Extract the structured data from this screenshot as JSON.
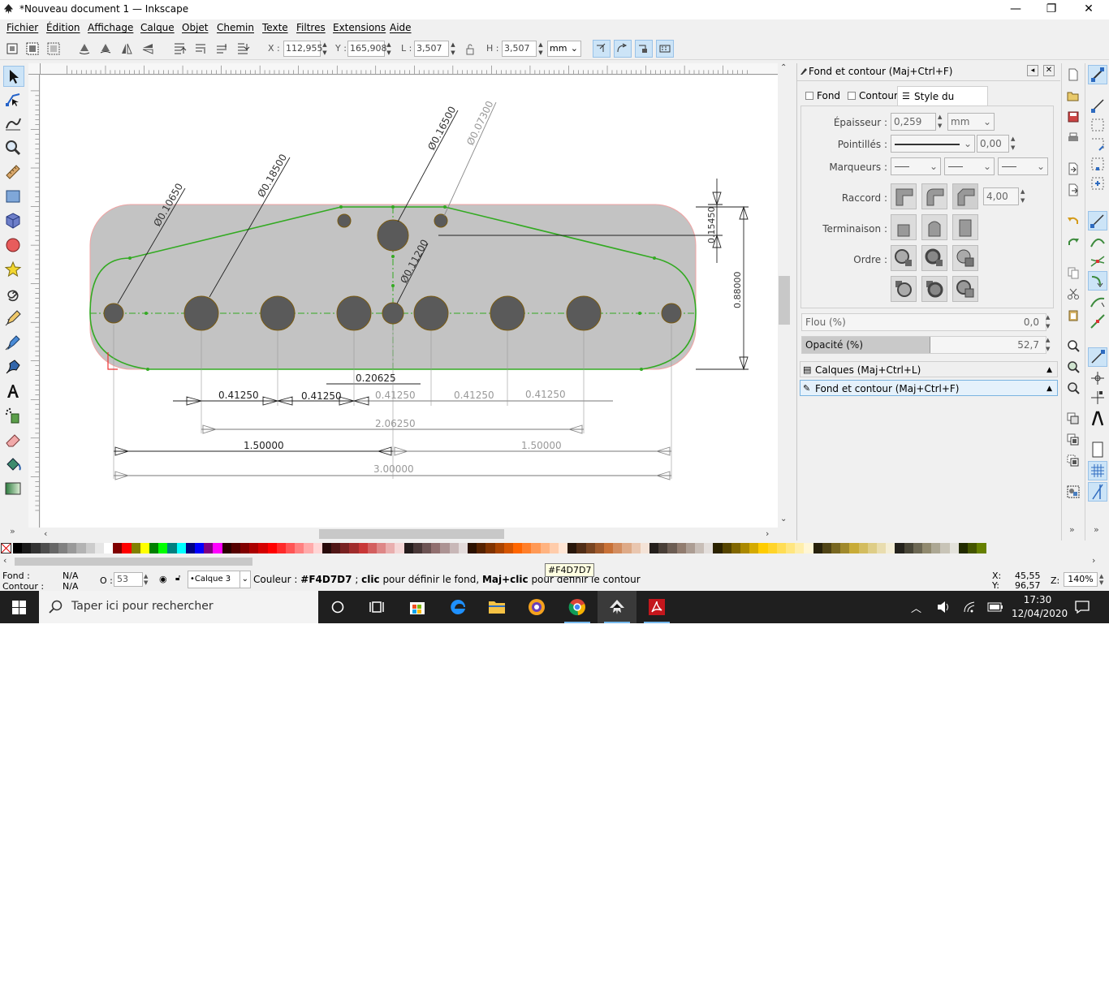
{
  "window": {
    "title": "*Nouveau document 1 — Inkscape",
    "minimize": "—",
    "restore": "❐",
    "close": "✕"
  },
  "menu": [
    "Fichier",
    "Édition",
    "Affichage",
    "Calque",
    "Objet",
    "Chemin",
    "Texte",
    "Filtres",
    "Extensions",
    "Aide"
  ],
  "controls": {
    "x_label": "X :",
    "x_value": "112,955",
    "y_label": "Y :",
    "y_value": "165,908",
    "w_label": "L :",
    "w_value": "3,507",
    "h_label": "H :",
    "h_value": "3,507",
    "unit": "mm"
  },
  "drawing": {
    "diameters": [
      "Ø0.10650",
      "Ø0.18500",
      "Ø0.16500",
      "Ø0.07300",
      "Ø0.11200"
    ],
    "dims": {
      "d_015450": "0.15450",
      "d_088000": "0.88000",
      "d_020625": "0.20625",
      "d_041250a": "0.41250",
      "d_041250b": "0.41250",
      "d_041250c": "0.41250",
      "d_041250d": "0.41250",
      "d_041250e": "0.41250",
      "d_206250": "2.06250",
      "d_150000a": "1.50000",
      "d_150000b": "1.50000",
      "d_300000": "3.00000"
    }
  },
  "dock": {
    "title": "Fond et contour (Maj+Ctrl+F)",
    "tabs": [
      "Fond",
      "Contour",
      "Style du contour"
    ],
    "stroke_width_label": "Épaisseur :",
    "stroke_width_value": "0,259",
    "stroke_unit": "mm",
    "dashes_label": "Pointillés :",
    "dash_offset": "0,00",
    "markers_label": "Marqueurs :",
    "join_label": "Raccord :",
    "miter_limit": "4,00",
    "cap_label": "Terminaison :",
    "order_label": "Ordre :",
    "blur_label": "Flou (%)",
    "blur_value": "0,0",
    "opacity_label": "Opacité (%)",
    "opacity_value": "52,7",
    "opacity_fraction": 0.527,
    "collapsed_dialog": "Calques (Maj+Ctrl+L)",
    "active_dialog": "Fond et contour (Maj+Ctrl+F)"
  },
  "palette_colors": [
    "#000000",
    "#1a1a1a",
    "#333333",
    "#4d4d4d",
    "#666666",
    "#808080",
    "#999999",
    "#b3b3b3",
    "#cccccc",
    "#e6e6e6",
    "#ffffff",
    "#800000",
    "#ff0000",
    "#808000",
    "#ffff00",
    "#008000",
    "#00ff00",
    "#008080",
    "#00ffff",
    "#000080",
    "#0000ff",
    "#800080",
    "#ff00ff",
    "#2b0000",
    "#550000",
    "#800000",
    "#aa0000",
    "#d40000",
    "#ff0000",
    "#ff2a2a",
    "#ff5555",
    "#ff8080",
    "#ffaaaa",
    "#ffd5d5",
    "#280b0b",
    "#501616",
    "#782121",
    "#a02c2c",
    "#c83737",
    "#d35f5f",
    "#de8787",
    "#e9afaf",
    "#f4d7d7",
    "#241c1c",
    "#483737",
    "#6c5353",
    "#916f6f",
    "#ac9393",
    "#c8b7b7",
    "#e3dbdb",
    "#2b1100",
    "#552200",
    "#803300",
    "#aa4400",
    "#d45500",
    "#ff6600",
    "#ff7f2a",
    "#ff9955",
    "#ffb380",
    "#ffccaa",
    "#ffe6d5",
    "#28170b",
    "#502d16",
    "#784421",
    "#a05a2c",
    "#c87137",
    "#d38d5f",
    "#deaa87",
    "#e9c6af",
    "#f4e3d7",
    "#241f1c",
    "#483e37",
    "#6c5d53",
    "#917c6f",
    "#ac9d93",
    "#c8beb7",
    "#e3dedb",
    "#2b2200",
    "#554400",
    "#806600",
    "#aa8800",
    "#d4aa00",
    "#ffcc00",
    "#ffd42a",
    "#ffdd55",
    "#ffe680",
    "#ffeeaa",
    "#fff6d5",
    "#28220b",
    "#504416",
    "#786721",
    "#a0892c",
    "#c8ab37",
    "#d3bc5f",
    "#decd87",
    "#e9ddaf",
    "#f4eed7",
    "#24221c",
    "#484537",
    "#6c6753",
    "#918a6f",
    "#aca793",
    "#c8c4b7",
    "#e3e2db",
    "#222b00",
    "#445500",
    "#668000"
  ],
  "status": {
    "fill_label": "Fond :",
    "fill_value": "N/A",
    "stroke_label": "Contour :",
    "stroke_value": "N/A",
    "opacity_label": "O :",
    "opacity_value": "53",
    "layer": "•Calque 3",
    "message_prefix": "Couleur : ",
    "message_color": "#F4D7D7",
    "message_mid": " ; ",
    "message_click": "clic",
    "message_mid2": " pour définir le fond, ",
    "message_shift": "Maj+clic",
    "message_end": " pour définir le contour",
    "tooltip": "#F4D7D7",
    "x_label": "X:",
    "x_value": "45,55",
    "y_label": "Y:",
    "y_value": "96,57",
    "zoom_label": "Z:",
    "zoom_value": "140%"
  },
  "taskbar": {
    "search_placeholder": "Taper ici pour rechercher",
    "time": "17:30",
    "date": "12/04/2020"
  }
}
